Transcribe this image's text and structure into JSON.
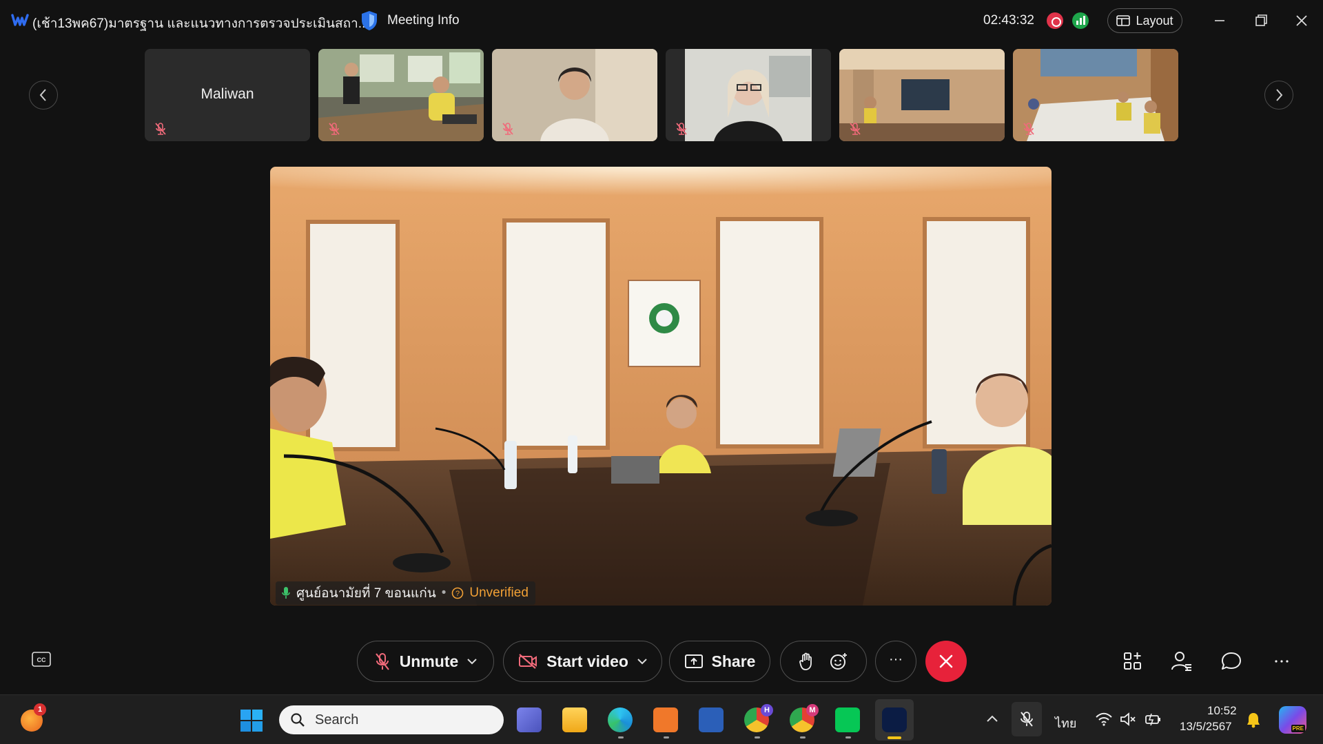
{
  "window": {
    "title": "(เช้า13พค67)มาตรฐาน และแนวทางการตรวจประเมินสถา...",
    "meeting_info_label": "Meeting Info",
    "elapsed_time": "02:43:32",
    "layout_label": "Layout"
  },
  "thumbnails": [
    {
      "name": "Maliwan",
      "muted": true
    },
    {
      "name": "",
      "muted": true
    },
    {
      "name": "",
      "muted": true
    },
    {
      "name": "",
      "muted": true
    },
    {
      "name": "",
      "muted": true
    },
    {
      "name": "",
      "muted": true
    }
  ],
  "active_speaker": {
    "name": "ศูนย์อนามัยที่ 7 ขอนแก่น",
    "status": "Unverified"
  },
  "controls": {
    "unmute_label": "Unmute",
    "start_video_label": "Start video",
    "share_label": "Share",
    "more_label": "···"
  },
  "taskbar": {
    "search_placeholder": "Search",
    "language": "ไทย",
    "clock_time": "10:52",
    "clock_date": "13/5/2567",
    "notification_count": "1",
    "teams_badge": "H",
    "chrome_badge": "M",
    "copilot_label": "PRE"
  },
  "colors": {
    "background": "#121212",
    "end_call": "#e7223a",
    "unverified": "#f1a035",
    "recording": "#e0334a",
    "network": "#1ea54b",
    "muted_icon": "#f06a7a"
  }
}
